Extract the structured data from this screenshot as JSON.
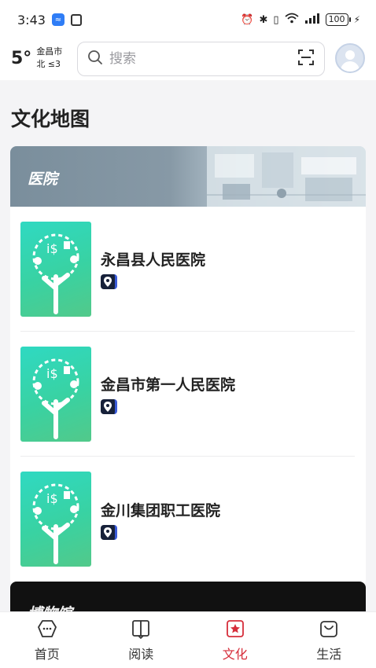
{
  "status_bar": {
    "time": "3:43",
    "battery": "100"
  },
  "header": {
    "temperature": "5°",
    "city": "金昌市",
    "wind": "北 ≤3",
    "search_placeholder": "搜索"
  },
  "page": {
    "title": "文化地图"
  },
  "categories": [
    {
      "title": "医院",
      "items": [
        {
          "name": "永昌县人民医院"
        },
        {
          "name": "金昌市第一人民医院"
        },
        {
          "name": "金川集团职工医院"
        }
      ]
    },
    {
      "title": "博物馆"
    }
  ],
  "tabs": [
    {
      "label": "首页",
      "icon": "home-icon"
    },
    {
      "label": "阅读",
      "icon": "book-icon"
    },
    {
      "label": "文化",
      "icon": "culture-star-icon",
      "active": true
    },
    {
      "label": "生活",
      "icon": "bag-icon"
    }
  ],
  "colors": {
    "active_tab": "#d62e3b",
    "thumb_gradient_start": "#2fd9c2",
    "thumb_gradient_end": "#52c98a",
    "location_button": "#17213a"
  }
}
